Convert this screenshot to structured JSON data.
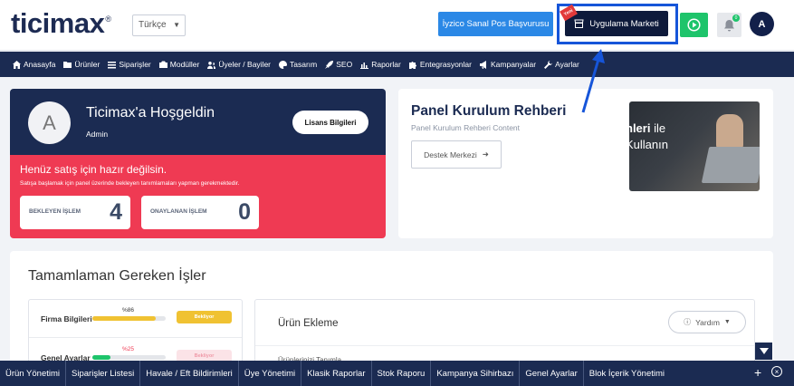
{
  "header": {
    "logo_text": "ticimax",
    "logo_mark": "®",
    "language": "Türkçe",
    "iyzico_label": "İyzico Sanal Pos Başvurusu",
    "market_label": "Uygulama Marketi",
    "market_badge": "Yeni",
    "notification_count": "0",
    "avatar_letter": "A"
  },
  "nav": {
    "items": [
      {
        "label": "Anasayfa",
        "icon": "home-icon"
      },
      {
        "label": "Ürünler",
        "icon": "folder-icon"
      },
      {
        "label": "Siparişler",
        "icon": "list-icon"
      },
      {
        "label": "Modüller",
        "icon": "camera-icon"
      },
      {
        "label": "Üyeler / Bayiler",
        "icon": "users-icon"
      },
      {
        "label": "Tasarım",
        "icon": "palette-icon"
      },
      {
        "label": "SEO",
        "icon": "rocket-icon"
      },
      {
        "label": "Raporlar",
        "icon": "chart-icon"
      },
      {
        "label": "Entegrasyonlar",
        "icon": "puzzle-icon"
      },
      {
        "label": "Kampanyalar",
        "icon": "megaphone-icon"
      },
      {
        "label": "Ayarlar",
        "icon": "wrench-icon"
      }
    ]
  },
  "welcome": {
    "avatar_letter": "A",
    "title": "Ticimax'a Hoşgeldin",
    "role": "Admin",
    "license_button": "Lisans Bilgileri",
    "warning_title": "Henüz satış için hazır değilsin.",
    "warning_sub": "Satışa başlamak için panel üzerinde bekleyen tanımlamaları yapman gerekmektedir.",
    "stats": [
      {
        "label": "BEKLEYEN İŞLEM",
        "value": "4"
      },
      {
        "label": "ONAYLANAN İŞLEM",
        "value": "0"
      }
    ]
  },
  "guide": {
    "title": "Panel Kurulum Rehberi",
    "subtitle": "Panel Kurulum Rehberi Content",
    "support_button": "Destek Merkezi",
    "image_text_bold": "nleri",
    "image_text_rest": " ile",
    "image_text_line2": "Kullanın"
  },
  "tasks": {
    "title": "Tamamlaman Gereken İşler",
    "items": [
      {
        "name": "Firma Bilgileri",
        "percent": "%86",
        "progress": 0.86,
        "status": "Bekliyor"
      },
      {
        "name": "Genel Ayarlar",
        "percent": "%25",
        "progress": 0.25,
        "status": "Bekliyor"
      }
    ],
    "product_panel": {
      "title": "Ürün Ekleme",
      "help_button": "Yardım",
      "sub_text": "Ürünlerinizi Tanımla"
    }
  },
  "bottom_bar": {
    "items": [
      "Ürün Yönetimi",
      "Siparişler Listesi",
      "Havale / Eft Bildirimleri",
      "Üye Yönetimi",
      "Klasik Raporlar",
      "Stok Raporu",
      "Kampanya Sihirbazı",
      "Genel Ayarlar",
      "Blok İçerik Yönetimi"
    ],
    "plus_label": "+",
    "close_label": "×"
  },
  "colors": {
    "navy": "#1b2b52",
    "red": "#ef3a53",
    "green": "#1ec46b",
    "blue": "#2b88e6",
    "highlight": "#1655d9",
    "yellow": "#f0c232"
  }
}
